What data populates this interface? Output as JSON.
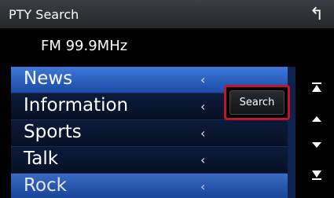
{
  "header": {
    "title": "PTY Search",
    "back_icon": "return-arrow-icon"
  },
  "frequency": "FM 99.9MHz",
  "list": {
    "items": [
      {
        "label": "News",
        "chevron": "‹",
        "selected": true
      },
      {
        "label": "Information",
        "chevron": "‹",
        "selected": false
      },
      {
        "label": "Sports",
        "chevron": "‹",
        "selected": false
      },
      {
        "label": "Talk",
        "chevron": "‹",
        "selected": false
      },
      {
        "label": "Rock",
        "chevron": "‹",
        "selected": false
      }
    ]
  },
  "search_button": {
    "label": "Search",
    "highlight_color": "#c0152a"
  },
  "scroll_buttons": [
    "scroll-to-top-icon",
    "scroll-up-icon",
    "scroll-down-icon",
    "scroll-to-bottom-icon"
  ],
  "colors": {
    "selected_row": "#2f64c4",
    "row_background": "#0a1634",
    "title_bar": "#303136"
  }
}
